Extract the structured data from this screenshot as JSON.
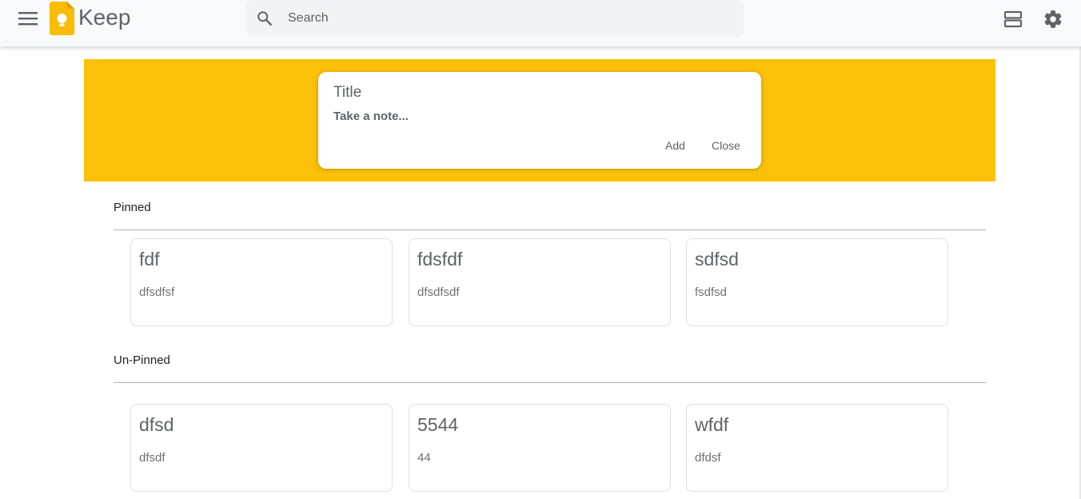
{
  "header": {
    "app_title": "Keep",
    "menu_icon": "hamburger-menu-icon",
    "logo_icon": "keep-bulb-logo-icon",
    "search": {
      "placeholder": "Search",
      "value": "",
      "icon": "search-icon"
    },
    "view_icon": "list-view-icon",
    "settings_icon": "gear-icon"
  },
  "note_form": {
    "title_placeholder": "Title",
    "body_placeholder": "Take a note...",
    "add_label": "Add",
    "close_label": "Close",
    "banner_color": "#fbc108"
  },
  "sections": {
    "pinned_label": "Pinned",
    "unpinned_label": "Un-Pinned"
  },
  "pinned_notes": [
    {
      "title": "fdf",
      "body": "dfsdfsf"
    },
    {
      "title": "fdsfdf",
      "body": "dfsdfsdf"
    },
    {
      "title": "sdfsd",
      "body": "fsdfsd"
    }
  ],
  "unpinned_notes": [
    {
      "title": "dfsd",
      "body": "dfsdf"
    },
    {
      "title": "5544",
      "body": "44"
    },
    {
      "title": "wfdf",
      "body": "dfdsf"
    }
  ],
  "colors": {
    "accent": "#fbc108",
    "logo": "#fbbc04",
    "text": "#5f6368"
  }
}
